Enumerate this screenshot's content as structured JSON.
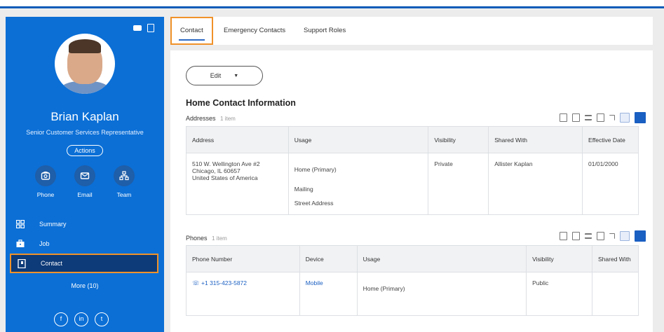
{
  "colors": {
    "sidebar": "#0b6fd6",
    "active_nav": "#0d3a78",
    "highlight": "#f0922a",
    "link": "#1a5fc2"
  },
  "profile": {
    "name": "Brian Kaplan",
    "title": "Senior Customer Services Representative",
    "actions_label": "Actions"
  },
  "quick_actions": [
    {
      "label": "Phone",
      "icon": "phone-icon"
    },
    {
      "label": "Email",
      "icon": "email-icon"
    },
    {
      "label": "Team",
      "icon": "org-chart-icon"
    }
  ],
  "nav": [
    {
      "label": "Summary",
      "icon": "dashboard-icon"
    },
    {
      "label": "Job",
      "icon": "briefcase-icon"
    },
    {
      "label": "Contact",
      "icon": "contact-card-icon",
      "active": true
    }
  ],
  "more_label": "More (10)",
  "social": [
    {
      "label": "f",
      "icon": "facebook-icon"
    },
    {
      "label": "in",
      "icon": "linkedin-icon"
    },
    {
      "label": "t",
      "icon": "twitter-icon"
    }
  ],
  "tabs": [
    {
      "label": "Contact",
      "active": true
    },
    {
      "label": "Emergency Contacts"
    },
    {
      "label": "Support Roles"
    }
  ],
  "edit_label": "Edit",
  "section_title": "Home Contact Information",
  "addresses": {
    "title": "Addresses",
    "count": "1 item",
    "columns": [
      "Address",
      "Usage",
      "Visibility",
      "Shared With",
      "Effective Date"
    ],
    "row": {
      "address_lines": [
        "510 W. Wellington Ave #2",
        "Chicago, IL 60657",
        "United States of America"
      ],
      "usage_lines": [
        "Home (Primary)",
        "Mailing",
        "Street Address"
      ],
      "visibility": "Private",
      "shared_with": "Allister Kaplan",
      "effective_date": "01/01/2000"
    }
  },
  "phones": {
    "title": "Phones",
    "count": "1 item",
    "columns": [
      "Phone Number",
      "Device",
      "Usage",
      "Visibility",
      "Shared With"
    ],
    "row": {
      "number": "+1 315-423-5872",
      "device": "Mobile",
      "usage": "Home (Primary)",
      "visibility": "Public",
      "shared_with": ""
    }
  }
}
